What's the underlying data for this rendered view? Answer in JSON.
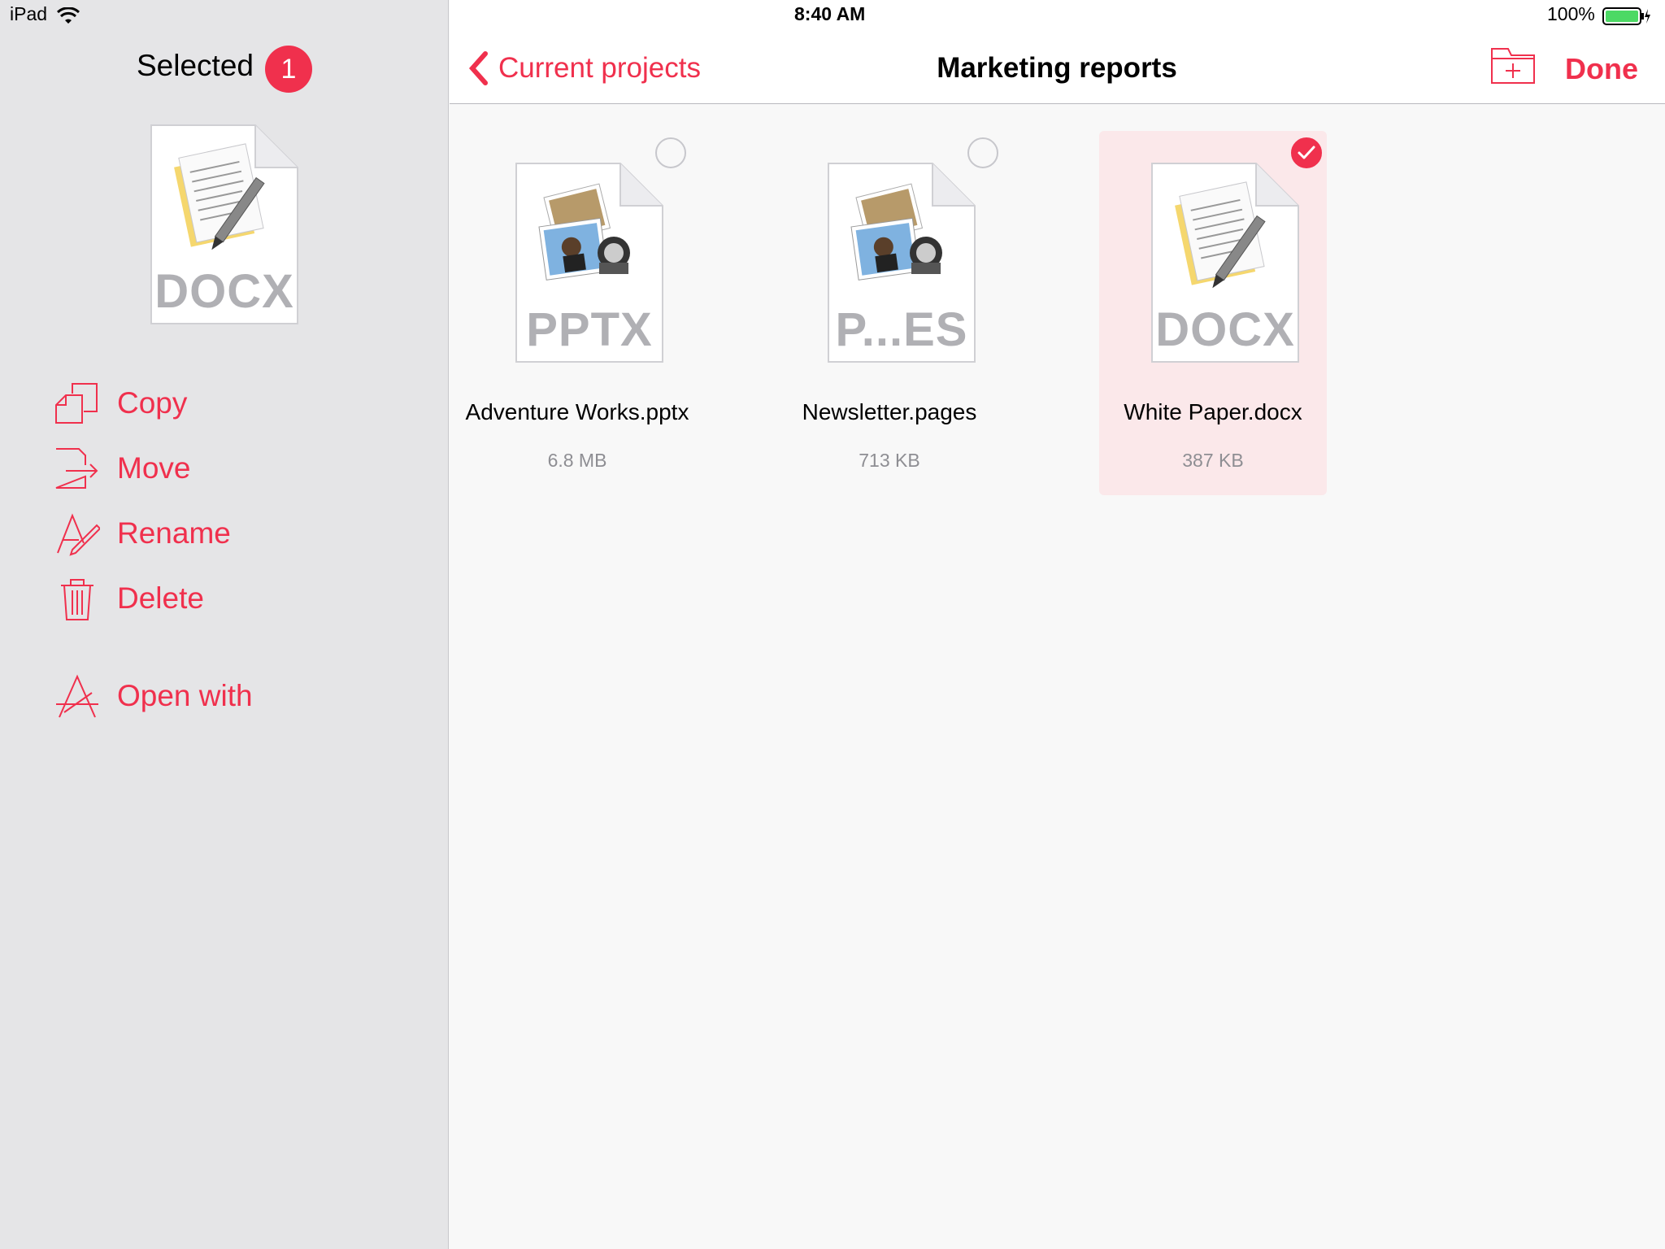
{
  "status_bar": {
    "device": "iPad",
    "time": "8:40 AM",
    "battery": "100%"
  },
  "sidebar": {
    "title": "Selected",
    "badge_count": "1",
    "preview_type": "DOCX",
    "actions": [
      {
        "label": "Copy",
        "icon": "copy-icon"
      },
      {
        "label": "Move",
        "icon": "move-icon"
      },
      {
        "label": "Rename",
        "icon": "rename-icon"
      },
      {
        "label": "Delete",
        "icon": "trash-icon"
      },
      {
        "label": "Open with",
        "icon": "app-store-icon"
      }
    ]
  },
  "navbar": {
    "back_label": "Current projects",
    "title": "Marketing reports",
    "done_label": "Done",
    "new_folder_icon": "new-folder-icon"
  },
  "files": [
    {
      "name": "Adventure Works.pptx",
      "size": "6.8 MB",
      "type_label": "PPTX",
      "selected": false
    },
    {
      "name": "Newsletter.pages",
      "size": "713 KB",
      "type_label": "P...ES",
      "selected": false
    },
    {
      "name": "White Paper.docx",
      "size": "387 KB",
      "type_label": "DOCX",
      "selected": true
    }
  ],
  "colors": {
    "accent": "#f0304d",
    "sidebar_bg": "#e5e5e7",
    "selected_tile": "#fbe8ea"
  }
}
